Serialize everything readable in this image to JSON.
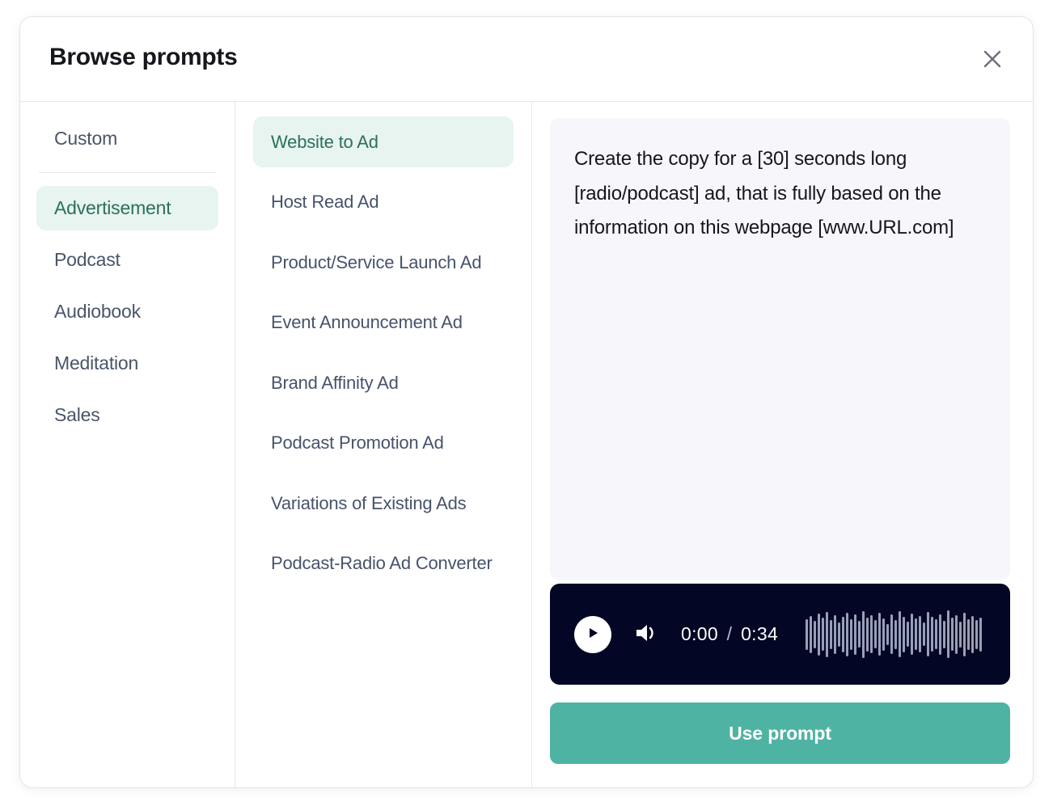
{
  "dialog": {
    "title": "Browse prompts",
    "close_icon": "close-icon"
  },
  "sidebar": {
    "items": [
      {
        "label": "Custom",
        "selected": false
      },
      {
        "label": "Advertisement",
        "selected": true
      },
      {
        "label": "Podcast",
        "selected": false
      },
      {
        "label": "Audiobook",
        "selected": false
      },
      {
        "label": "Meditation",
        "selected": false
      },
      {
        "label": "Sales",
        "selected": false
      }
    ]
  },
  "prompt_list": {
    "items": [
      {
        "label": "Website to Ad",
        "selected": true
      },
      {
        "label": "Host Read Ad",
        "selected": false
      },
      {
        "label": "Product/Service Launch Ad",
        "selected": false
      },
      {
        "label": "Event Announcement Ad",
        "selected": false
      },
      {
        "label": "Brand Affinity Ad",
        "selected": false
      },
      {
        "label": "Podcast Promotion Ad",
        "selected": false
      },
      {
        "label": "Variations of Existing Ads",
        "selected": false
      },
      {
        "label": "Podcast-Radio Ad Converter",
        "selected": false
      }
    ]
  },
  "detail": {
    "prompt_text": "Create the copy for a [30] seconds long [radio/podcast] ad, that is fully based on the information on this webpage [www.URL.com]",
    "player": {
      "play_icon": "play-icon",
      "volume_icon": "volume-icon",
      "current_time": "0:00",
      "time_separator": "/",
      "total_time": "0:34",
      "waveform_heights": [
        38,
        46,
        34,
        52,
        41,
        56,
        36,
        48,
        30,
        44,
        54,
        38,
        50,
        33,
        58,
        42,
        47,
        35,
        53,
        40,
        26,
        49,
        36,
        57,
        44,
        31,
        51,
        39,
        45,
        29,
        55,
        43,
        37,
        50,
        34,
        59,
        41,
        48,
        32,
        54,
        38,
        46,
        36,
        42
      ]
    },
    "use_prompt_label": "Use prompt"
  },
  "colors": {
    "accent_teal": "#4fb3a3",
    "selected_pill_bg": "#e7f4ef",
    "selected_pill_text": "#2c7157",
    "player_bg": "#030624",
    "prompt_box_bg": "#f7f6fb",
    "waveform_bar": "#98a0b8"
  }
}
